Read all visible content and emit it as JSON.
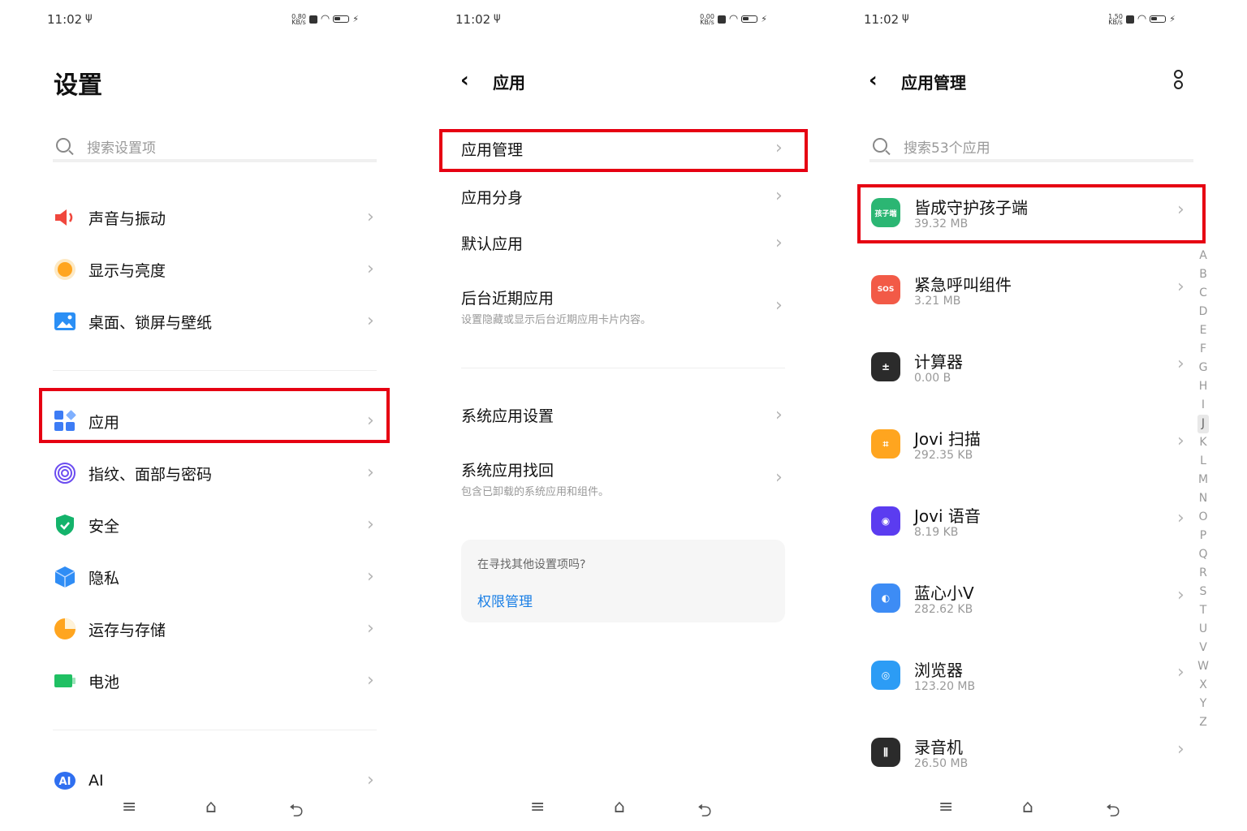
{
  "status": {
    "time": "11:02",
    "usb": "ψ",
    "speeds": [
      {
        "value": "0.80",
        "unit": "KB/s"
      },
      {
        "value": "0.00",
        "unit": "KB/s"
      },
      {
        "value": "1.50",
        "unit": "KB/s"
      }
    ]
  },
  "panel1": {
    "title": "设置",
    "search_placeholder": "搜索设置项",
    "items": [
      {
        "label": "声音与振动",
        "icon": "speaker-icon",
        "color": "#f0473d"
      },
      {
        "label": "显示与亮度",
        "icon": "sun-icon",
        "color": "#ffa51f"
      },
      {
        "label": "桌面、锁屏与壁纸",
        "icon": "wallpaper-icon",
        "color": "#2b8ff5"
      },
      {
        "label": "应用",
        "icon": "apps-icon",
        "color": "#3d7cf5"
      },
      {
        "label": "指纹、面部与密码",
        "icon": "fingerprint-icon",
        "color": "#6b4cf0"
      },
      {
        "label": "安全",
        "icon": "shield-icon",
        "color": "#14b36b"
      },
      {
        "label": "隐私",
        "icon": "privacy-cube-icon",
        "color": "#2f8df5"
      },
      {
        "label": "运存与存储",
        "icon": "pie-icon",
        "color": "#ffa51f"
      },
      {
        "label": "电池",
        "icon": "battery-icon",
        "color": "#20c063"
      },
      {
        "label": "AI",
        "icon": "ai-icon",
        "color": "#2f6ff0"
      }
    ]
  },
  "panel2": {
    "title": "应用",
    "items": [
      {
        "label": "应用管理"
      },
      {
        "label": "应用分身"
      },
      {
        "label": "默认应用"
      },
      {
        "label": "后台近期应用",
        "sub": "设置隐藏或显示后台近期应用卡片内容。"
      },
      {
        "label": "系统应用设置"
      },
      {
        "label": "系统应用找回",
        "sub": "包含已卸载的系统应用和组件。"
      }
    ],
    "card_question": "在寻找其他设置项吗?",
    "card_link": "权限管理"
  },
  "panel3": {
    "title": "应用管理",
    "search_placeholder": "搜索53个应用",
    "apps": [
      {
        "name": "皆成守护孩子端",
        "size": "39.32 MB",
        "icon": "guardian-kid-icon",
        "color": "#2bb673",
        "glyph": "孩子端"
      },
      {
        "name": "紧急呼叫组件",
        "size": "3.21 MB",
        "icon": "sos-icon",
        "color": "#f25a47",
        "glyph": "SOS"
      },
      {
        "name": "计算器",
        "size": "0.00 B",
        "icon": "calculator-icon",
        "color": "#2b2b2b",
        "glyph": "±"
      },
      {
        "name": "Jovi 扫描",
        "size": "292.35 KB",
        "icon": "scan-icon",
        "color": "#ffa51f",
        "glyph": "⌗"
      },
      {
        "name": "Jovi 语音",
        "size": "8.19 KB",
        "icon": "voice-icon",
        "color": "#5b3cf0",
        "glyph": "◉"
      },
      {
        "name": "蓝心小V",
        "size": "282.62 KB",
        "icon": "bluev-icon",
        "color": "#3d8cf5",
        "glyph": "◐"
      },
      {
        "name": "浏览器",
        "size": "123.20 MB",
        "icon": "browser-icon",
        "color": "#2c9cf5",
        "glyph": "◎"
      },
      {
        "name": "录音机",
        "size": "26.50 MB",
        "icon": "recorder-icon",
        "color": "#2b2b2b",
        "glyph": "⫼"
      }
    ],
    "alphabet": [
      "A",
      "B",
      "C",
      "D",
      "E",
      "F",
      "G",
      "H",
      "I",
      "J",
      "K",
      "L",
      "M",
      "N",
      "O",
      "P",
      "Q",
      "R",
      "S",
      "T",
      "U",
      "V",
      "W",
      "X",
      "Y",
      "Z"
    ],
    "alphabet_selected": "J"
  },
  "colors": {
    "highlight": "#e60012",
    "link": "#1a7fe5"
  }
}
